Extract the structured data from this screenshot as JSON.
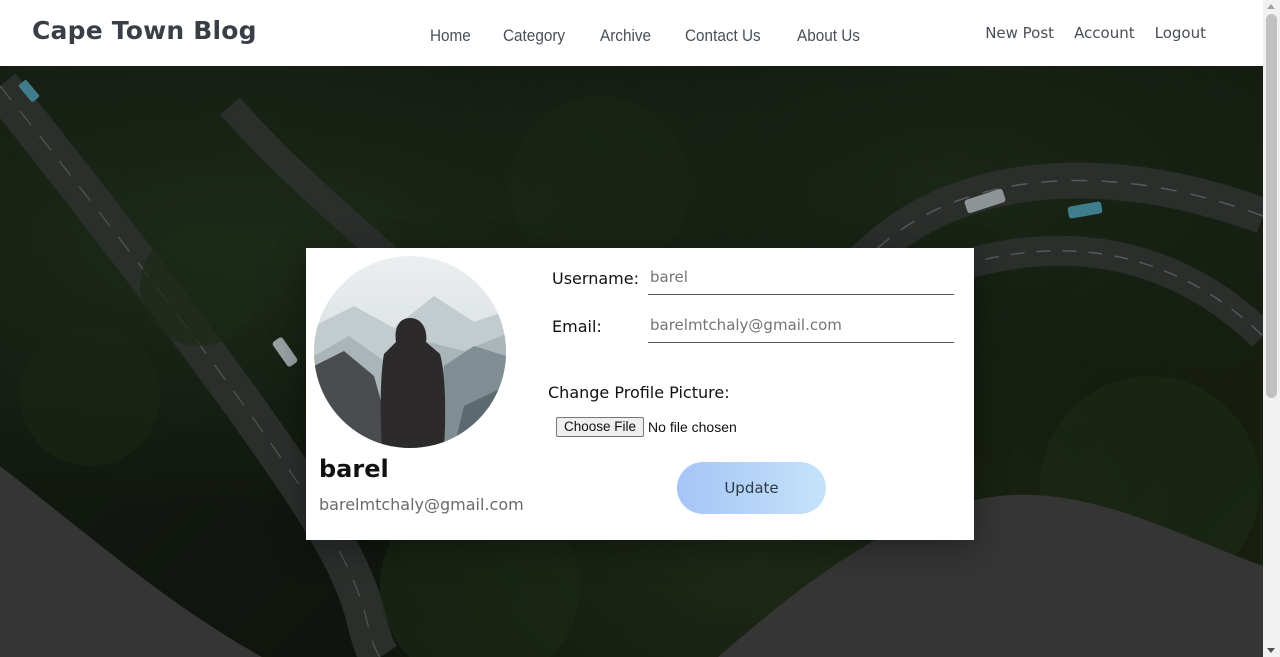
{
  "brand": "Cape Town Blog",
  "nav": {
    "center": [
      "Home",
      "Category",
      "Archive",
      "Contact Us",
      "About Us"
    ],
    "right": [
      "New Post",
      "Account",
      "Logout"
    ]
  },
  "profile": {
    "name": "barel",
    "email": "barelmtchaly@gmail.com"
  },
  "form": {
    "username_label": "Username:",
    "username_placeholder": "barel",
    "email_label": "Email:",
    "email_placeholder": "barelmtchaly@gmail.com",
    "picture_label": "Change Profile Picture:",
    "file_button": "Choose File",
    "file_status": "No file chosen",
    "update_button": "Update"
  },
  "colors": {
    "accent_gradient_start": "#a7c4f7",
    "accent_gradient_end": "#c5e3f9",
    "hero_dark": "#141b12"
  }
}
